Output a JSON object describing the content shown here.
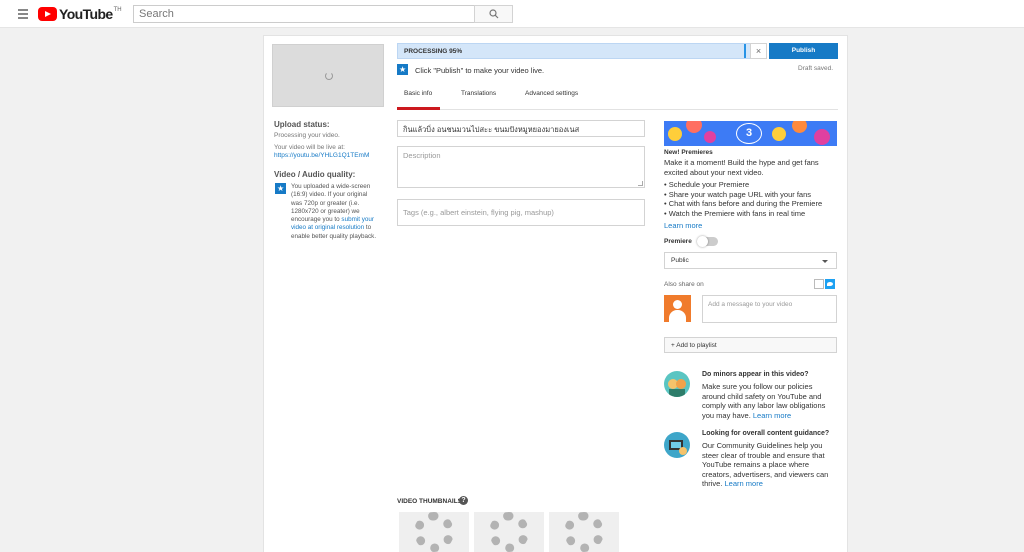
{
  "header": {
    "logo_text": "YouTube",
    "region": "TH",
    "search_placeholder": "Search"
  },
  "left": {
    "upload_status_title": "Upload status:",
    "upload_status_text": "Processing your video.",
    "live_at": "Your video will be live at:",
    "live_link": "https://youtu.be/YHLG1Q1TEmM",
    "vaq_title": "Video / Audio quality:",
    "vaq_text_1": "You uploaded a wide-screen (16:9) video. If your original was 720p or greater (i.e. 1280x720 or greater) we encourage you to ",
    "vaq_link": "submit your video at original resolution",
    "vaq_text_2": " to enable better quality playback."
  },
  "processing": {
    "label": "PROCESSING 95%",
    "progress": 0.95,
    "close": "×",
    "publish": "Publish",
    "draft_saved": "Draft saved.",
    "tip": "Click \"Publish\" to make your video live."
  },
  "tabs": [
    {
      "label": "Basic info",
      "active": true
    },
    {
      "label": "Translations",
      "active": false
    },
    {
      "label": "Advanced settings",
      "active": false
    }
  ],
  "form": {
    "title_value": "กินแล้วบิ่ง   อนชนมวนไปสะะ ขนมปังหมูหยองมายองเนส",
    "description_placeholder": "Description",
    "tags_placeholder": "Tags (e.g., albert einstein, flying pig, mashup)"
  },
  "thumbnails": {
    "title": "VIDEO THUMBNAILS",
    "help": "?"
  },
  "premieres": {
    "banner_number": "3",
    "title": "New! Premieres",
    "text": "Make it a moment! Build the hype and get fans excited about your next video.",
    "bullets": [
      "• Schedule your Premiere",
      "• Share your watch page URL with your fans",
      "• Chat with fans before and during the Premiere",
      "• Watch the Premiere with fans in real time"
    ],
    "learn_more": "Learn more",
    "premiere_label": "Premiere",
    "premiere_enabled": false
  },
  "privacy": {
    "selected": "Public"
  },
  "share": {
    "also_share": "Also share on",
    "message_placeholder": "Add a message to your video",
    "add_playlist": "+ Add to playlist"
  },
  "tips": [
    {
      "title": "Do minors appear in this video?",
      "body": "Make sure you follow our policies around child safety on YouTube and comply with any labor law obligations you may have. ",
      "link": "Learn more"
    },
    {
      "title": "Looking for overall content guidance?",
      "body": "Our Community Guidelines help you steer clear of trouble and ensure that YouTube remains a place where creators, advertisers, and viewers can thrive. ",
      "link": "Learn more"
    }
  ],
  "colors": {
    "accent_blue": "#167ac6",
    "youtube_red": "#ff0000",
    "tab_underline": "#cc181e",
    "processing_bg": "#d4e6f9"
  }
}
